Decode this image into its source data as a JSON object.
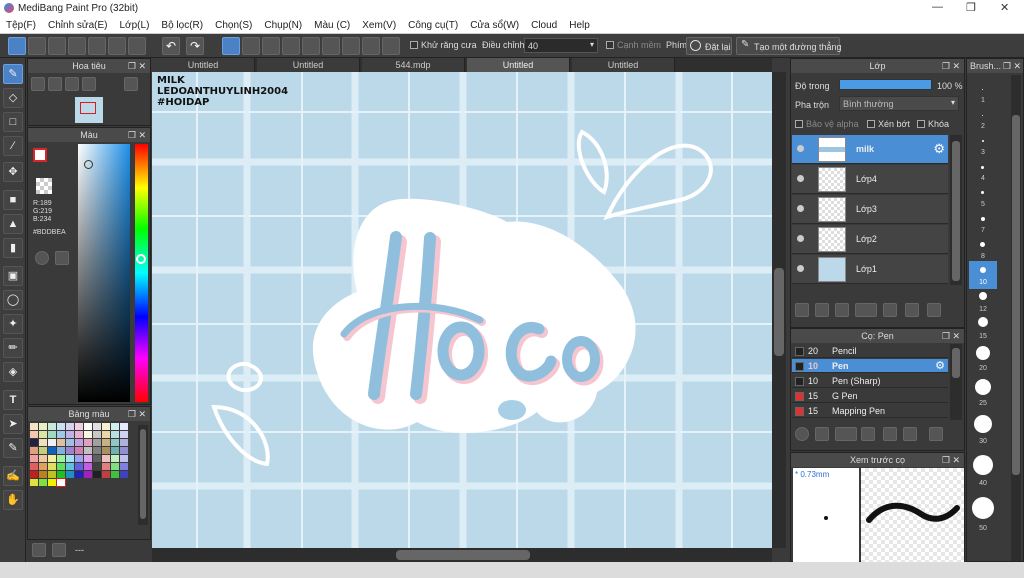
{
  "window": {
    "title": "MediBang Paint Pro (32bit)",
    "controls": [
      "—",
      "❒",
      "✕"
    ]
  },
  "menu": [
    "Tệp(F)",
    "Chỉnh sửa(E)",
    "Lớp(L)",
    "Bộ lọc(R)",
    "Chọn(S)",
    "Chụp(N)",
    "Màu (C)",
    "Xem(V)",
    "Công cụ(T)",
    "Cửa sổ(W)",
    "Cloud",
    "Help"
  ],
  "toolbar": {
    "antialias_label": "Khử răng cưa",
    "adjust_label": "Điều chỉnh",
    "adjust_value": "40",
    "edge_label": "Cạnh mềm",
    "key_label": "Phím",
    "place_label": "Đặt lại",
    "straight_label": "Tạo một đường thẳng"
  },
  "navigator": {
    "title": "Hoa tiêu"
  },
  "color": {
    "title": "Màu",
    "r": "R:189",
    "g": "G:219",
    "b": "B:234",
    "hex": "#BDDBEA",
    "fg": "#d9262b",
    "current": "#bddbea"
  },
  "palette": {
    "title": "Bảng màu",
    "footer": "---"
  },
  "tabs": [
    "Untitled",
    "Untitled",
    "544.mdp",
    "Untitled",
    "Untitled"
  ],
  "canvas": {
    "notes": [
      "MILK",
      "LEDOANTHUYLINH2004",
      "#HOIDAP"
    ]
  },
  "layers": {
    "title": "Lớp",
    "opacity_label": "Độ trong",
    "opacity_value": "100 %",
    "blend_label": "Pha trộn",
    "blend_value": "Bình thường",
    "protect_alpha": "Bảo vệ alpha",
    "clip": "Xén bớt",
    "lock": "Khóa",
    "items": [
      "milk",
      "Lớp4",
      "Lớp3",
      "Lớp2",
      "Lớp1"
    ]
  },
  "brush": {
    "title": "Cọ: Pen",
    "items": [
      {
        "size": "20",
        "name": "Pencil",
        "color": "#222222"
      },
      {
        "size": "10",
        "name": "Pen",
        "color": "#222222"
      },
      {
        "size": "10",
        "name": "Pen (Sharp)",
        "color": "#222222"
      },
      {
        "size": "15",
        "name": "G Pen",
        "color": "#e03030"
      },
      {
        "size": "15",
        "name": "Mapping Pen",
        "color": "#e03030"
      }
    ]
  },
  "preview": {
    "title": "Xem trước cọ",
    "size": "* 0.73mm"
  },
  "brushsize": {
    "title": "Brush...",
    "sizes": [
      "1",
      "2",
      "3",
      "4",
      "5",
      "7",
      "8",
      "10",
      "12",
      "15",
      "20",
      "25",
      "30",
      "40",
      "50"
    ]
  }
}
